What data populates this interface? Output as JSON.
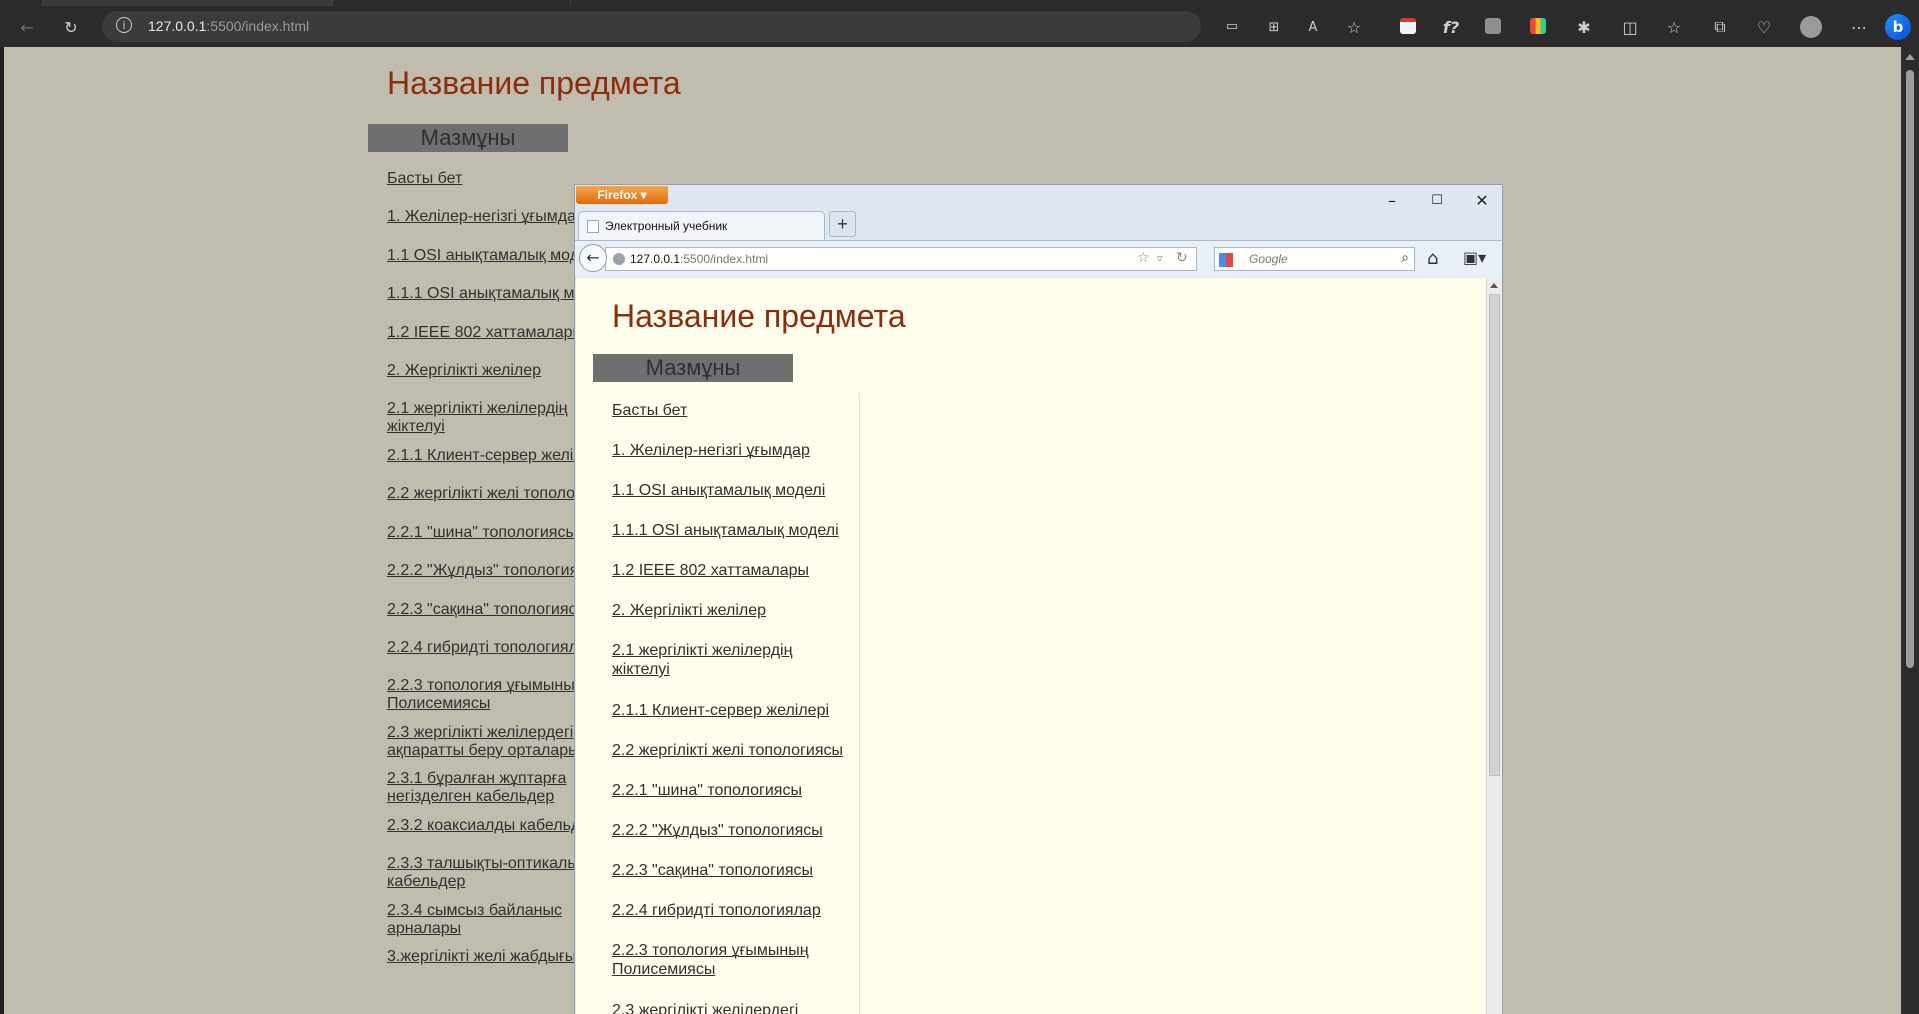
{
  "edge": {
    "url_host": "127.0.0.1",
    "url_path": ":5500/index.html",
    "back_icon": "back-arrow-icon",
    "reload_icon": "reload-icon"
  },
  "page": {
    "title": "Название предмета",
    "toc_heading": "Мазмұны",
    "toc_items": [
      "Басты бет",
      "1. Желілер-негізгі ұғымдар",
      "1.1 OSI анықтамалық моделі",
      "1.1.1 OSI анықтамалық моделі",
      "1.2 IEEE 802 хаттамалары",
      "2. Жергілікті желілер",
      "2.1 жергілікті желілердің\nжіктелуі",
      "2.1.1 Клиент-сервер желілері",
      "2.2 жергілікті желі топологиясы",
      "2.2.1 \"шина\" топологиясы",
      "2.2.2 \"Жұлдыз\" топологиясы",
      "2.2.3 \"сақина\" топологиясы",
      "2.2.4 гибридті топологиялар",
      "2.2.3 топология ұғымының\nПолисемиясы",
      "2.3 жергілікті желілердегі\nақпаратты беру орталары",
      "2.3.1 бұралған жұптарға\nнегізделген кабельдер",
      "2.3.2 коаксиалды кабельдер",
      "2.3.3 талшықты-оптикалық\nкабельдер",
      "2.3.4 сымсыз байланыс\nарналары",
      "3.жергілікті желі жабдығы"
    ]
  },
  "firefox": {
    "menu_button": "Firefox",
    "tab_title": "Электронный учебник",
    "url_host": "127.0.0.1",
    "url_path": ":5500/index.html",
    "search_placeholder": "Google",
    "new_tab_label": "+",
    "content": {
      "title": "Название предмета",
      "toc_heading": "Мазмұны",
      "toc_items": [
        "Басты бет",
        "1. Желілер-негізгі ұғымдар",
        "1.1 OSI анықтамалық моделі",
        "1.1.1 OSI анықтамалық моделі",
        "1.2 IEEE 802 хаттамалары",
        "2. Жергілікті желілер",
        "2.1 жергілікті желілердің\nжіктелуі",
        "2.1.1 Клиент-сервер желілері",
        "2.2 жергілікті желі топологиясы",
        "2.2.1 \"шина\" топологиясы",
        "2.2.2 \"Жұлдыз\" топологиясы",
        "2.2.3 \"сақина\" топологиясы",
        "2.2.4 гибридті топологиялар",
        "2.2.3 топология ұғымының\nПолисемиясы",
        "2.3 жергілікті желілердегі"
      ]
    }
  },
  "colors": {
    "page_bg": "#c0bdae",
    "title": "#8b2d0c",
    "toc_head_bg": "#6f6f6f",
    "ff_content_bg": "#fffdeb"
  }
}
